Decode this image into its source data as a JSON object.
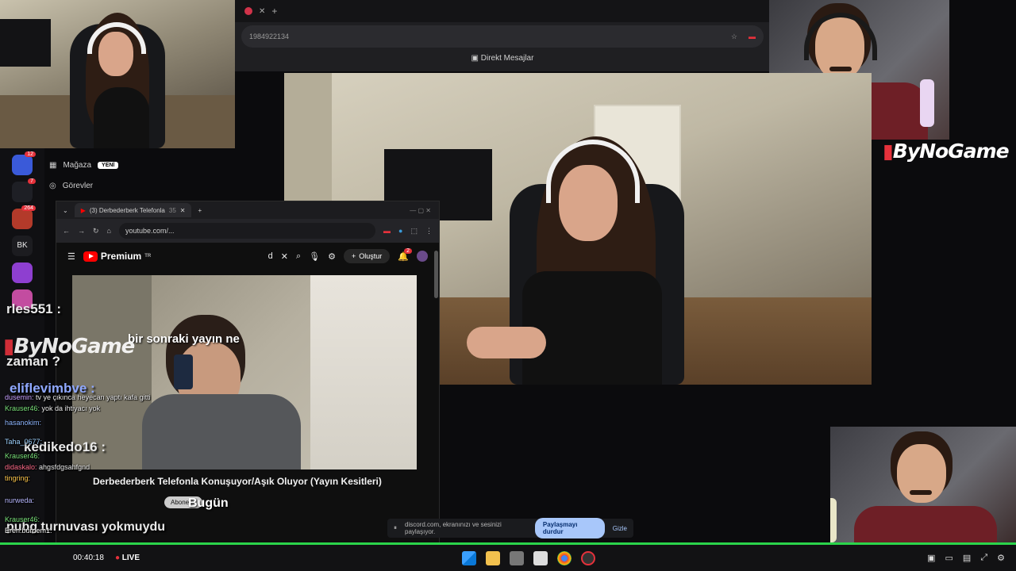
{
  "top_browser": {
    "url_fragment": "1984922134",
    "panel_title": "Direkt Mesajlar"
  },
  "brand": {
    "logo_text": "ByNoGame",
    "overlay_logo_text": "ByNoGame"
  },
  "left_menu": {
    "items": [
      {
        "label": "Mağaza",
        "badge": "YENİ"
      },
      {
        "label": "Görevler"
      }
    ]
  },
  "app_sidebar": {
    "icons": [
      {
        "name": "app-icon-1",
        "badge": "12",
        "color": "#3a5ad9"
      },
      {
        "name": "app-icon-2",
        "badge": "7",
        "color": "#1e1f25"
      },
      {
        "name": "app-icon-3",
        "badge": "264",
        "color": "#b33a2a"
      },
      {
        "name": "app-icon-bk",
        "label": "BK",
        "color": "#1c1c20"
      },
      {
        "name": "app-icon-4",
        "color": "#8e3fd0"
      },
      {
        "name": "app-icon-5",
        "color": "#c34ca0"
      }
    ]
  },
  "youtube_window": {
    "tab_title": "(3) Derbederberk Telefonla",
    "tab_badge": "35",
    "url": "youtube.com/...",
    "logo": "Premium",
    "logo_sup": "TR",
    "search_fragment": "d",
    "create_label": "Oluştur",
    "notif_count": "2",
    "video_caption": "bir sonraki yayın ne",
    "video_title": "Derbederberk Telefonla Konuşuyor/Aşık Oluyor (Yayın Kesitleri)",
    "subscribe_label": "Abone ol",
    "today_label": "Bugün"
  },
  "chat": {
    "big_lines": [
      "rles551 :",
      "zaman ?",
      "eliflevimbve :",
      "kedikedo16 :",
      "pubg turnuvası yokmuydu"
    ],
    "messages": [
      {
        "user": "dusemin:",
        "text": "tv ye çıkınca heyecan yaptı kafa gitti",
        "color": "#c7a0ff"
      },
      {
        "user": "Krauser46:",
        "text": "yok da ihtiyacı yok",
        "color": "#7be37b"
      },
      {
        "user": "hasanokim:",
        "text": "",
        "color": "#8fb6ff"
      },
      {
        "user": "Taha_0677:",
        "text": "",
        "color": "#9ed2ff"
      },
      {
        "user": "Krauser46:",
        "text": "",
        "color": "#7be37b"
      },
      {
        "user": "didaskalo:",
        "text": "ahgsfdgsahfgnd",
        "color": "#ff6b8a"
      },
      {
        "user": "tingring:",
        "text": "",
        "color": "#ffc94d"
      },
      {
        "user": "nurweda:",
        "text": "",
        "color": "#b8b8ff"
      },
      {
        "user": "Krauser46:",
        "text": "",
        "color": "#7be37b"
      },
      {
        "user": "Eren:burdem1:",
        "text": "",
        "color": "#ffffff"
      }
    ]
  },
  "share_bar": {
    "text": "discord.com, ekranınızı ve sesinizi paylaşıyor.",
    "stop_button": "Paylaşmayı durdur",
    "hide_button": "Gizle"
  },
  "stream": {
    "timer": "00:40:18",
    "live_label": "LIVE"
  },
  "colors": {
    "progress_green": "#2bd44b",
    "youtube_red": "#ff0000",
    "share_button_bg": "#a8c7fa"
  }
}
